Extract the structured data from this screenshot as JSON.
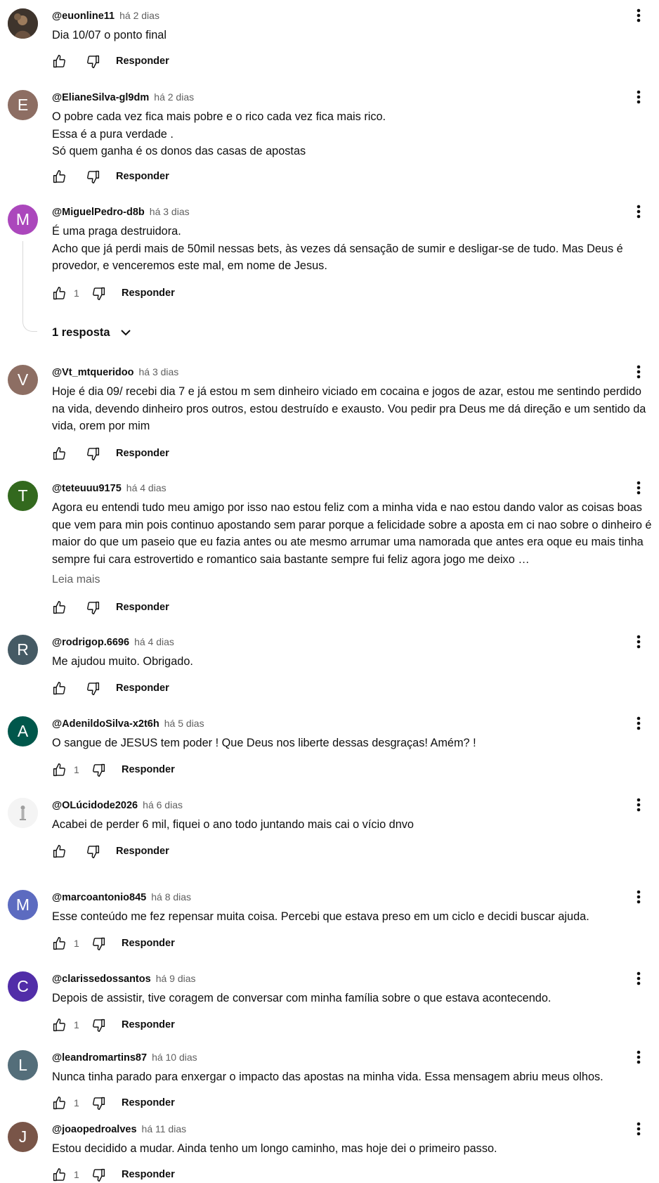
{
  "reply_label": "Responder",
  "comments": [
    {
      "author": "@euonline11",
      "time": "há 2 dias",
      "text": "Dia 10/07 o ponto final",
      "likes": "",
      "avatar_letter": "",
      "avatar_color": "#5a4a3a"
    },
    {
      "author": "@ElianeSilva-gl9dm",
      "time": "há 2 dias",
      "text": "O pobre cada vez fica mais pobre e o rico cada vez fica mais rico.\nEssa é a pura verdade .\nSó quem ganha é os donos das casas de apostas",
      "likes": "",
      "avatar_letter": "E",
      "avatar_color": "#8d6e63"
    },
    {
      "author": "@MiguelPedro-d8b",
      "time": "há 3 dias",
      "text": "É uma praga destruidora.\nAcho que já perdi mais de 50mil nessas bets, às vezes dá sensação de sumir e desligar-se de tudo. Mas Deus é provedor, e venceremos este mal, em nome de Jesus.",
      "likes": "1",
      "avatar_letter": "M",
      "avatar_color": "#ab47bc",
      "replies_label": "1 resposta"
    },
    {
      "author": "@Vt_mtqueridoo",
      "time": "há 3 dias",
      "text": "Hoje é dia 09/ recebi dia 7 e já estou m sem dinheiro viciado em cocaina e jogos de azar, estou me sentindo perdido na vida, devendo dinheiro pros outros, estou destruído e exausto. Vou pedir pra Deus me dá direção e um sentido da vida, orem por mim",
      "likes": "",
      "avatar_letter": "V",
      "avatar_color": "#8d6e63"
    },
    {
      "author": "@teteuuu9175",
      "time": "há 4 dias",
      "text": "Agora eu entendi tudo meu amigo por isso nao estou feliz com a minha vida e nao estou dando valor as coisas boas que vem para min pois continuo apostando sem parar porque a felicidade sobre a aposta em ci nao sobre o dinheiro é maior do que um paseio que eu fazia antes ou ate mesmo arrumar uma namorada que antes era oque eu mais tinha sempre fui cara estrovertido e romantico saia bastante sempre fui feliz agora jogo me deixo …",
      "likes": "",
      "avatar_letter": "T",
      "avatar_color": "#33691e",
      "read_more": "Leia mais"
    },
    {
      "author": "@rodrigop.6696",
      "time": "há 4 dias",
      "text": "Me ajudou muito. Obrigado.",
      "likes": "",
      "avatar_letter": "R",
      "avatar_color": "#455a64"
    },
    {
      "author": "@AdenildoSilva-x2t6h",
      "time": "há 5 dias",
      "text": "O sangue de JESUS tem poder ! Que Deus nos liberte dessas desgraças! Amém? !",
      "likes": "1",
      "avatar_letter": "A",
      "avatar_color": "#00574b"
    },
    {
      "author": "@OLúcidode2026",
      "time": "há 6 dias",
      "text": "Acabei de perder 6 mil, fiquei o ano todo juntando mais cai o vício dnvo",
      "likes": "",
      "avatar_letter": "",
      "avatar_color": "#f2f2f2"
    },
    {
      "author": "@marcoantonio845",
      "time": "há 8 dias",
      "text": "Esse conteúdo me fez repensar muita coisa. Percebi que estava preso em um ciclo e decidi buscar ajuda.",
      "likes": "1",
      "avatar_letter": "M",
      "avatar_color": "#5c6bc0"
    },
    {
      "author": "@clarissedossantos",
      "time": "há 9 dias",
      "text": "Depois de assistir, tive coragem de conversar com minha família sobre o que estava acontecendo.",
      "likes": "1",
      "avatar_letter": "C",
      "avatar_color": "#512da8"
    },
    {
      "author": "@leandromartins87",
      "time": "há 10 dias",
      "text": "Nunca tinha parado para enxergar o impacto das apostas na minha vida. Essa mensagem abriu meus olhos.",
      "likes": "1",
      "avatar_letter": "L",
      "avatar_color": "#546e7a"
    },
    {
      "author": "@joaopedroalves",
      "time": "há 11 dias",
      "text": "Estou decidido a mudar. Ainda tenho um longo caminho, mas hoje dei o primeiro passo.",
      "likes": "1",
      "avatar_letter": "J",
      "avatar_color": "#795548"
    }
  ]
}
